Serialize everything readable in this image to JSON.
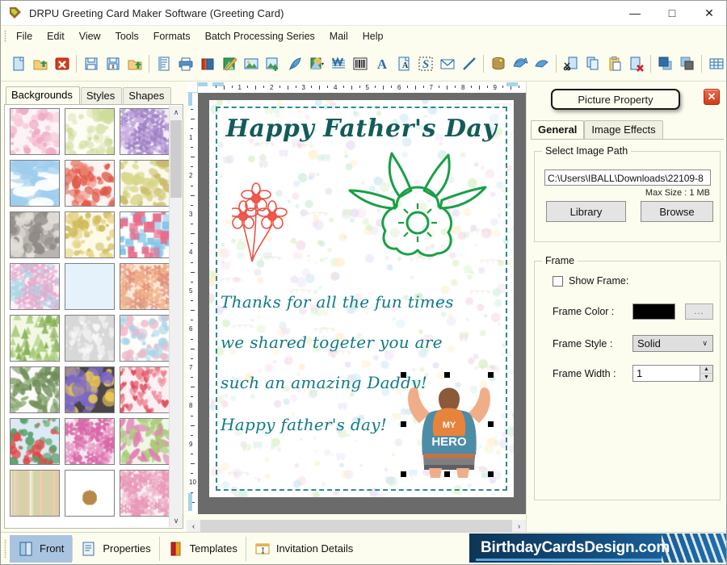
{
  "window": {
    "title": "DRPU Greeting Card Maker Software (Greeting Card)",
    "app_icon": "app-icon",
    "minimize": "—",
    "maximize": "□",
    "close": "✕"
  },
  "menu": {
    "items": [
      {
        "label": "File"
      },
      {
        "label": "Edit"
      },
      {
        "label": "View"
      },
      {
        "label": "Tools"
      },
      {
        "label": "Formats"
      },
      {
        "label": "Batch Processing Series"
      },
      {
        "label": "Mail"
      },
      {
        "label": "Help"
      }
    ],
    "overflow": "»"
  },
  "toolbar": {
    "overflow": "»",
    "buttons": [
      {
        "name": "new-document-icon",
        "glyph": "page"
      },
      {
        "name": "open-folder-icon",
        "glyph": "open"
      },
      {
        "name": "close-document-icon",
        "glyph": "redx"
      },
      {
        "name": "separator",
        "glyph": "sep"
      },
      {
        "name": "save-icon",
        "glyph": "save"
      },
      {
        "name": "save-as-icon",
        "glyph": "saveas"
      },
      {
        "name": "import-folder-icon",
        "glyph": "openup"
      },
      {
        "name": "separator",
        "glyph": "sep"
      },
      {
        "name": "page-setup-icon",
        "glyph": "doclines"
      },
      {
        "name": "print-icon",
        "glyph": "printer"
      },
      {
        "name": "card-stack-icon",
        "glyph": "stack"
      },
      {
        "name": "pen-color-icon",
        "glyph": "penart"
      },
      {
        "name": "insert-image-icon",
        "glyph": "photo"
      },
      {
        "name": "add-object-icon",
        "glyph": "addobj"
      },
      {
        "name": "pen-tool-icon",
        "glyph": "quill"
      },
      {
        "name": "shape-fill-icon",
        "glyph": "shapefill"
      },
      {
        "name": "watermark-icon",
        "glyph": "wmark"
      },
      {
        "name": "barcode-icon",
        "glyph": "barcode"
      },
      {
        "name": "text-tool-icon",
        "glyph": "bigA"
      },
      {
        "name": "text-page-icon",
        "glyph": "textpage"
      },
      {
        "name": "signature-icon",
        "glyph": "sigS"
      },
      {
        "name": "email-icon",
        "glyph": "envelope"
      },
      {
        "name": "line-tool-icon",
        "glyph": "diagline"
      },
      {
        "name": "separator",
        "glyph": "sep"
      },
      {
        "name": "database-icon",
        "glyph": "database"
      },
      {
        "name": "undo-icon",
        "glyph": "undo"
      },
      {
        "name": "redo-icon",
        "glyph": "redo"
      },
      {
        "name": "separator",
        "glyph": "sep"
      },
      {
        "name": "cut-icon",
        "glyph": "cut"
      },
      {
        "name": "copy-icon",
        "glyph": "copy"
      },
      {
        "name": "paste-icon",
        "glyph": "paste"
      },
      {
        "name": "delete-icon",
        "glyph": "delpage"
      },
      {
        "name": "separator",
        "glyph": "sep"
      },
      {
        "name": "bring-front-icon",
        "glyph": "front"
      },
      {
        "name": "send-back-icon",
        "glyph": "back"
      },
      {
        "name": "separator",
        "glyph": "sep"
      },
      {
        "name": "grid-icon",
        "glyph": "grid"
      },
      {
        "name": "zoom-actual-icon",
        "glyph": "onetoone"
      }
    ]
  },
  "sidebar": {
    "tabs": [
      {
        "label": "Backgrounds",
        "active": true
      },
      {
        "label": "Styles",
        "active": false
      },
      {
        "label": "Shapes",
        "active": false
      }
    ],
    "scroll_up": "∧",
    "scroll_down": "∨",
    "thumbnails": [
      {
        "name": "bg-baby-pink",
        "c1": "#fdf3f6",
        "c2": "#f7c8d8",
        "c3": "#f0a9c4",
        "pat": "dots"
      },
      {
        "name": "bg-baby-pastel",
        "c1": "#fdfdf2",
        "c2": "#dfe6b8",
        "c3": "#cddc9a",
        "pat": "sparse"
      },
      {
        "name": "bg-purple-floral",
        "c1": "#f4eefa",
        "c2": "#c9aee0",
        "c3": "#9d7ec4",
        "pat": "bloom"
      },
      {
        "name": "bg-blue-sky",
        "c1": "#bfe0f5",
        "c2": "#ffffff",
        "c3": "#9ecdee",
        "pat": "clouds"
      },
      {
        "name": "bg-strawberry",
        "c1": "#fdf4f2",
        "c2": "#f08878",
        "c3": "#e05a48",
        "pat": "berry"
      },
      {
        "name": "bg-fruit-pastel",
        "c1": "#fbf8ec",
        "c2": "#d9d88a",
        "c3": "#c9bb6a",
        "pat": "berry"
      },
      {
        "name": "bg-grey-stones",
        "c1": "#b8b4b0",
        "c2": "#e2ded8",
        "c3": "#8f8a85",
        "pat": "stones"
      },
      {
        "name": "bg-confetti-beige",
        "c1": "#fdfae6",
        "c2": "#e8d58a",
        "c3": "#d0b95a",
        "pat": "confetti"
      },
      {
        "name": "bg-gift-boxes",
        "c1": "#ffffff",
        "c2": "#7fc4e8",
        "c3": "#e86a8a",
        "pat": "gifts"
      },
      {
        "name": "bg-flower-pastel",
        "c1": "#fdf2f8",
        "c2": "#a9d8e8",
        "c3": "#e8a8cc",
        "pat": "bloom"
      },
      {
        "name": "bg-snowflake",
        "c1": "#e6f2fb",
        "c2": "#ffffff",
        "c3": "#b8d8ee",
        "pat": "snow"
      },
      {
        "name": "bg-mandala-peach",
        "c1": "#fde8d8",
        "c2": "#f0b088",
        "c3": "#e0907a",
        "pat": "bloom"
      },
      {
        "name": "bg-pine-trees",
        "c1": "#f2f8e4",
        "c2": "#a8cc78",
        "c3": "#88b055",
        "pat": "trees"
      },
      {
        "name": "bg-white-heart",
        "c1": "#d8d8d8",
        "c2": "#f8f8f8",
        "c3": "#eeeeee",
        "pat": "heart"
      },
      {
        "name": "bg-party-doodle",
        "c1": "#fdfdfa",
        "c2": "#f0b8c8",
        "c3": "#a8d4e8",
        "pat": "confetti"
      },
      {
        "name": "bg-green-leaf",
        "c1": "#fbfbf8",
        "c2": "#8fae78",
        "c3": "#6f8e58",
        "pat": "leaf"
      },
      {
        "name": "bg-bokeh-lights",
        "c1": "#4a4448",
        "c2": "#e8c858",
        "c3": "#7a68c8",
        "pat": "bokeh"
      },
      {
        "name": "bg-red-hearts",
        "c1": "#fdf0f2",
        "c2": "#f08898",
        "c3": "#e04858",
        "pat": "hearts"
      },
      {
        "name": "bg-santa-blue",
        "c1": "#dceaf4",
        "c2": "#e04848",
        "c3": "#5aa06a",
        "pat": "confetti"
      },
      {
        "name": "bg-pink-bloom",
        "c1": "#f8eaf2",
        "c2": "#e898c8",
        "c3": "#d868a8",
        "pat": "bloom"
      },
      {
        "name": "bg-green-floral",
        "c1": "#eef6e4",
        "c2": "#a8cc78",
        "c3": "#e878b8",
        "pat": "leaf"
      },
      {
        "name": "bg-stripes-pastel",
        "c1": "#fbf6ec",
        "c2": "#e8c8a8",
        "c3": "#c8d8a8",
        "pat": "stripes"
      },
      {
        "name": "bg-teddy-bear",
        "c1": "#ffffff",
        "c2": "#d8a868",
        "c3": "#b88848",
        "pat": "teddy"
      },
      {
        "name": "bg-pink-soft",
        "c1": "#fdf0f4",
        "c2": "#f0b8cc",
        "c3": "#e898b8",
        "pat": "bloom"
      }
    ]
  },
  "canvas": {
    "ruler_h_labels": [
      "1",
      "2",
      "3",
      "4",
      "5",
      "6",
      "7",
      "8",
      "9"
    ],
    "ruler_v_labels": [
      "1",
      "2",
      "3",
      "4",
      "5",
      "6",
      "7",
      "8",
      "9",
      "10"
    ],
    "h_scroll_left": "‹",
    "h_scroll_right": "›",
    "card": {
      "title": "Happy Father's Day",
      "lines": [
        "Thanks for all the fun times",
        "we shared togeter you are",
        "such an amazing Daddy!",
        "Happy father's day!"
      ],
      "title_color": "#125b5b",
      "body_color": "#117a85",
      "selected_image": "my-hero-dad-illustration",
      "hero_shirt_text": "HERO",
      "hero_badge_text": "MY"
    }
  },
  "picture_property": {
    "title": "Picture Property",
    "close_glyph": "✕",
    "tabs": [
      {
        "label": "General",
        "active": true
      },
      {
        "label": "Image Effects",
        "active": false
      }
    ],
    "image_group": {
      "legend": "Select Image Path",
      "path_value": "C:\\Users\\IBALL\\Downloads\\22109-8",
      "max_size": "Max Size : 1 MB",
      "library_label": "Library",
      "browse_label": "Browse"
    },
    "frame_group": {
      "legend": "Frame",
      "show_frame_label": "Show Frame:",
      "show_frame_checked": false,
      "frame_color_label": "Frame Color :",
      "frame_color_value": "#000000",
      "color_picker_label": "...",
      "frame_style_label": "Frame Style :",
      "frame_style_value": "Solid",
      "frame_style_caret": "∨",
      "frame_width_label": "Frame Width :",
      "frame_width_value": "1",
      "spin_up": "▲",
      "spin_down": "▼"
    }
  },
  "bottombar": {
    "items": [
      {
        "label": "Front",
        "icon": "front-card-icon",
        "active": true
      },
      {
        "label": "Properties",
        "icon": "properties-icon",
        "active": false
      },
      {
        "label": "Templates",
        "icon": "templates-icon",
        "active": false
      },
      {
        "label": "Invitation Details",
        "icon": "invitation-details-icon",
        "active": false
      }
    ],
    "brand": "BirthdayCardsDesign.com"
  }
}
